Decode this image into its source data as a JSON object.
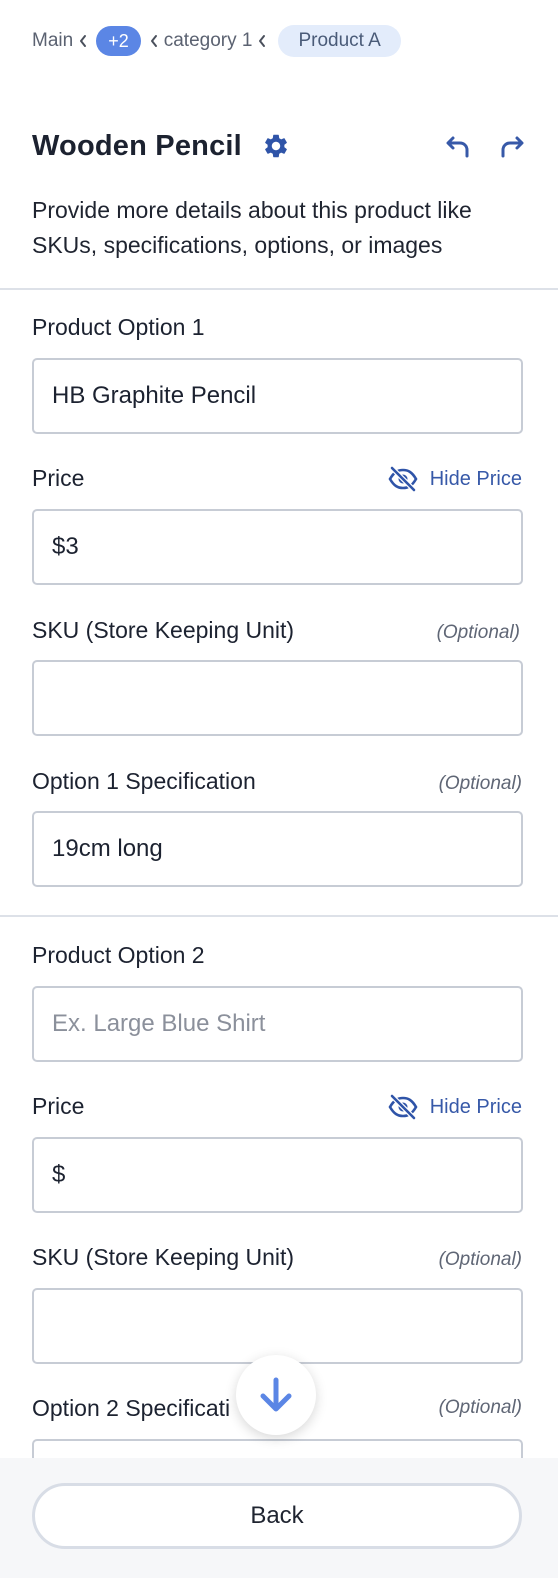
{
  "breadcrumb": {
    "items": [
      "Main",
      "+2",
      "category 1",
      "Product A"
    ]
  },
  "header": {
    "title": "Wooden Pencil",
    "description": "Provide more details about this product like SKUs, specifications, options, or images"
  },
  "option1": {
    "label": "Product Option 1",
    "value": "HB Graphite Pencil",
    "price_label": "Price",
    "hide_price_label": "Hide Price",
    "price_value": "$3",
    "sku_label": "SKU (Store Keeping Unit)",
    "sku_optional": "(Optional)",
    "sku_value": "",
    "spec_label": "Option 1 Specification",
    "spec_optional": "(Optional)",
    "spec_value": "19cm long"
  },
  "option2": {
    "label": "Product Option 2",
    "placeholder": "Ex. Large Blue Shirt",
    "price_label": "Price",
    "hide_price_label": "Hide Price",
    "price_value": "$",
    "sku_label": "SKU (Store Keeping Unit)",
    "sku_optional": "(Optional)",
    "sku_value": "",
    "spec_label": "Option 2 Specificati",
    "spec_optional": "(Optional)"
  },
  "footer": {
    "back_label": "Back"
  },
  "icons": {
    "settings": "gear-icon",
    "undo": "undo-icon",
    "redo": "redo-icon",
    "hide": "eye-slash-icon",
    "scroll": "arrow-down-icon"
  },
  "colors": {
    "accent": "#3759a8",
    "pill": "#5b86e5",
    "pill_light": "#e3ecfb",
    "border": "#c7ccd5"
  }
}
